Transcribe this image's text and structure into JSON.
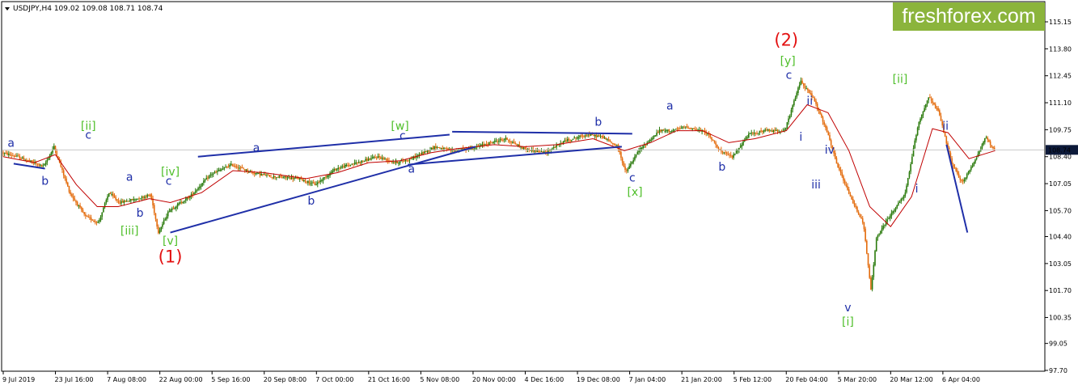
{
  "header": {
    "symbol_line": "USDJPY,H4  109.02 109.08 108.71 108.74"
  },
  "logo": {
    "text": "freshforex.com",
    "background": "#8bb43c"
  },
  "colors": {
    "candle_up": "#2a7a0c",
    "candle_down": "#e36b0c",
    "moving_average": "#c00000",
    "trend_lines": "#1f2fa8",
    "wave_blue": "#1f2fa8",
    "wave_green": "#4fbf2a",
    "wave_red": "#e31010",
    "price_line": "#c8c8c8"
  },
  "chart_data": {
    "type": "candlestick",
    "symbol": "USDJPY",
    "timeframe": "H4",
    "ohlc_last": {
      "open": 109.02,
      "high": 109.08,
      "low": 108.71,
      "close": 108.74
    },
    "current_price": 108.74,
    "current_price_label": "108.74",
    "ylim": [
      97.05,
      116.0
    ],
    "y_ticks": [
      "115.15",
      "113.80",
      "112.45",
      "111.10",
      "109.75",
      "108.40",
      "107.05",
      "105.70",
      "104.40",
      "103.05",
      "101.70",
      "100.35",
      "99.05",
      "97.70"
    ],
    "x_ticks": [
      "9 Jul 2019",
      "23 Jul 16:00",
      "7 Aug 08:00",
      "22 Aug 00:00",
      "5 Sep 16:00",
      "20 Sep 08:00",
      "7 Oct 00:00",
      "21 Oct 16:00",
      "5 Nov 08:00",
      "20 Nov 00:00",
      "4 Dec 16:00",
      "19 Dec 08:00",
      "7 Jan 04:00",
      "21 Jan 20:00",
      "5 Feb 12:00",
      "20 Feb 04:00",
      "5 Mar 20:00",
      "20 Mar 12:00",
      "6 Apr 04:00"
    ],
    "price_path": [
      [
        0,
        108.6
      ],
      [
        0.3,
        108.4
      ],
      [
        0.8,
        107.9
      ],
      [
        1.0,
        108.9
      ],
      [
        1.3,
        106.6
      ],
      [
        1.6,
        105.4
      ],
      [
        1.85,
        105.1
      ],
      [
        2.05,
        106.6
      ],
      [
        2.25,
        106.1
      ],
      [
        2.6,
        106.3
      ],
      [
        2.85,
        106.5
      ],
      [
        3.0,
        104.6
      ],
      [
        3.2,
        105.7
      ],
      [
        3.6,
        106.4
      ],
      [
        4.0,
        107.5
      ],
      [
        4.4,
        108.0
      ],
      [
        4.8,
        107.6
      ],
      [
        5.2,
        107.4
      ],
      [
        5.7,
        107.3
      ],
      [
        6.0,
        107.0
      ],
      [
        6.4,
        107.8
      ],
      [
        6.8,
        108.1
      ],
      [
        7.2,
        108.4
      ],
      [
        7.55,
        108.1
      ],
      [
        7.85,
        108.3
      ],
      [
        8.3,
        108.9
      ],
      [
        8.6,
        108.7
      ],
      [
        9.0,
        108.8
      ],
      [
        9.35,
        109.1
      ],
      [
        9.65,
        109.3
      ],
      [
        10.0,
        108.8
      ],
      [
        10.4,
        108.6
      ],
      [
        10.8,
        109.2
      ],
      [
        11.2,
        109.5
      ],
      [
        11.5,
        109.4
      ],
      [
        11.8,
        108.9
      ],
      [
        11.95,
        107.6
      ],
      [
        12.2,
        108.7
      ],
      [
        12.6,
        109.7
      ],
      [
        12.85,
        109.7
      ],
      [
        13.1,
        109.9
      ],
      [
        13.5,
        109.6
      ],
      [
        13.8,
        108.6
      ],
      [
        14.0,
        108.4
      ],
      [
        14.3,
        109.5
      ],
      [
        14.6,
        109.7
      ],
      [
        15.0,
        109.7
      ],
      [
        15.3,
        112.2
      ],
      [
        15.55,
        111.3
      ],
      [
        15.8,
        109.7
      ],
      [
        16.0,
        108.0
      ],
      [
        16.25,
        106.4
      ],
      [
        16.5,
        105.1
      ],
      [
        16.65,
        101.7
      ],
      [
        16.75,
        104.3
      ],
      [
        17.0,
        105.4
      ],
      [
        17.3,
        106.5
      ],
      [
        17.55,
        110.0
      ],
      [
        17.75,
        111.4
      ],
      [
        17.95,
        110.6
      ],
      [
        18.2,
        108.0
      ],
      [
        18.4,
        107.1
      ],
      [
        18.6,
        108.0
      ],
      [
        18.85,
        109.4
      ],
      [
        19.0,
        108.74
      ]
    ],
    "moving_average": [
      [
        0,
        108.4
      ],
      [
        0.6,
        108.1
      ],
      [
        1.0,
        108.5
      ],
      [
        1.4,
        107.0
      ],
      [
        1.8,
        105.9
      ],
      [
        2.2,
        105.9
      ],
      [
        2.8,
        106.3
      ],
      [
        3.2,
        106.1
      ],
      [
        3.8,
        106.6
      ],
      [
        4.4,
        107.7
      ],
      [
        5.0,
        107.6
      ],
      [
        5.8,
        107.3
      ],
      [
        6.4,
        107.6
      ],
      [
        7.0,
        108.1
      ],
      [
        7.6,
        108.2
      ],
      [
        8.2,
        108.6
      ],
      [
        8.7,
        108.8
      ],
      [
        9.4,
        109.0
      ],
      [
        10.0,
        108.9
      ],
      [
        10.6,
        109.0
      ],
      [
        11.3,
        109.3
      ],
      [
        11.9,
        108.7
      ],
      [
        12.4,
        109.1
      ],
      [
        12.9,
        109.7
      ],
      [
        13.4,
        109.7
      ],
      [
        13.9,
        109.1
      ],
      [
        14.4,
        109.3
      ],
      [
        15.0,
        109.7
      ],
      [
        15.4,
        111.0
      ],
      [
        15.8,
        110.6
      ],
      [
        16.2,
        108.7
      ],
      [
        16.6,
        105.9
      ],
      [
        17.0,
        104.9
      ],
      [
        17.4,
        106.4
      ],
      [
        17.8,
        109.8
      ],
      [
        18.1,
        109.6
      ],
      [
        18.5,
        108.3
      ],
      [
        19.0,
        108.7
      ]
    ],
    "trend_lines": [
      {
        "from": [
          3.73,
          108.4
        ],
        "to": [
          8.55,
          109.5
        ]
      },
      {
        "from": [
          3.2,
          104.6
        ],
        "to": [
          9.05,
          108.9
        ]
      },
      {
        "from": [
          7.75,
          108.0
        ],
        "to": [
          11.85,
          108.9
        ]
      },
      {
        "from": [
          8.6,
          109.65
        ],
        "to": [
          12.05,
          109.55
        ]
      },
      {
        "from": [
          0.2,
          108.05
        ],
        "to": [
          0.8,
          107.8
        ]
      },
      {
        "from": [
          18.07,
          109.0
        ],
        "to": [
          18.47,
          104.6
        ]
      }
    ],
    "wave_labels": [
      {
        "text": "a",
        "x": 0.15,
        "y": 108.9,
        "color": "blue"
      },
      {
        "text": "b",
        "x": 0.8,
        "y": 107.0,
        "color": "blue"
      },
      {
        "text": "c",
        "x": 1.63,
        "y": 109.3,
        "color": "blue"
      },
      {
        "text": "[ii]",
        "x": 1.63,
        "y": 109.75,
        "color": "green"
      },
      {
        "text": "a",
        "x": 2.42,
        "y": 107.2,
        "color": "blue"
      },
      {
        "text": "b",
        "x": 2.62,
        "y": 105.4,
        "color": "blue"
      },
      {
        "text": "[iii]",
        "x": 2.42,
        "y": 104.5,
        "color": "green"
      },
      {
        "text": "c",
        "x": 3.17,
        "y": 107.0,
        "color": "blue"
      },
      {
        "text": "[iv]",
        "x": 3.2,
        "y": 107.45,
        "color": "green"
      },
      {
        "text": "[v]",
        "x": 3.2,
        "y": 104.0,
        "color": "green"
      },
      {
        "text": "(1)",
        "x": 3.2,
        "y": 103.1,
        "color": "red"
      },
      {
        "text": "a",
        "x": 4.85,
        "y": 108.65,
        "color": "blue"
      },
      {
        "text": "b",
        "x": 5.9,
        "y": 106.0,
        "color": "blue"
      },
      {
        "text": "[w]",
        "x": 7.6,
        "y": 109.75,
        "color": "green"
      },
      {
        "text": "c",
        "x": 7.65,
        "y": 109.25,
        "color": "blue"
      },
      {
        "text": "a",
        "x": 7.82,
        "y": 107.6,
        "color": "blue"
      },
      {
        "text": "b",
        "x": 11.4,
        "y": 109.95,
        "color": "blue"
      },
      {
        "text": "c",
        "x": 12.05,
        "y": 107.15,
        "color": "blue"
      },
      {
        "text": "[x]",
        "x": 12.1,
        "y": 106.45,
        "color": "green"
      },
      {
        "text": "a",
        "x": 12.77,
        "y": 110.75,
        "color": "blue"
      },
      {
        "text": "b",
        "x": 13.77,
        "y": 107.7,
        "color": "blue"
      },
      {
        "text": "[y]",
        "x": 15.03,
        "y": 113.0,
        "color": "green"
      },
      {
        "text": "c",
        "x": 15.05,
        "y": 112.3,
        "color": "blue"
      },
      {
        "text": "(2)",
        "x": 15.0,
        "y": 113.95,
        "color": "red"
      },
      {
        "text": "ii",
        "x": 15.45,
        "y": 111.0,
        "color": "blue"
      },
      {
        "text": "i",
        "x": 15.28,
        "y": 109.2,
        "color": "blue"
      },
      {
        "text": "iv",
        "x": 15.83,
        "y": 108.55,
        "color": "blue"
      },
      {
        "text": "iii",
        "x": 15.57,
        "y": 106.8,
        "color": "blue"
      },
      {
        "text": "v",
        "x": 16.18,
        "y": 100.65,
        "color": "blue"
      },
      {
        "text": "[i]",
        "x": 16.18,
        "y": 99.95,
        "color": "green"
      },
      {
        "text": "[ii]",
        "x": 17.18,
        "y": 112.1,
        "color": "green"
      },
      {
        "text": "i",
        "x": 17.5,
        "y": 106.6,
        "color": "blue"
      },
      {
        "text": "ii",
        "x": 18.05,
        "y": 109.75,
        "color": "blue"
      }
    ]
  }
}
